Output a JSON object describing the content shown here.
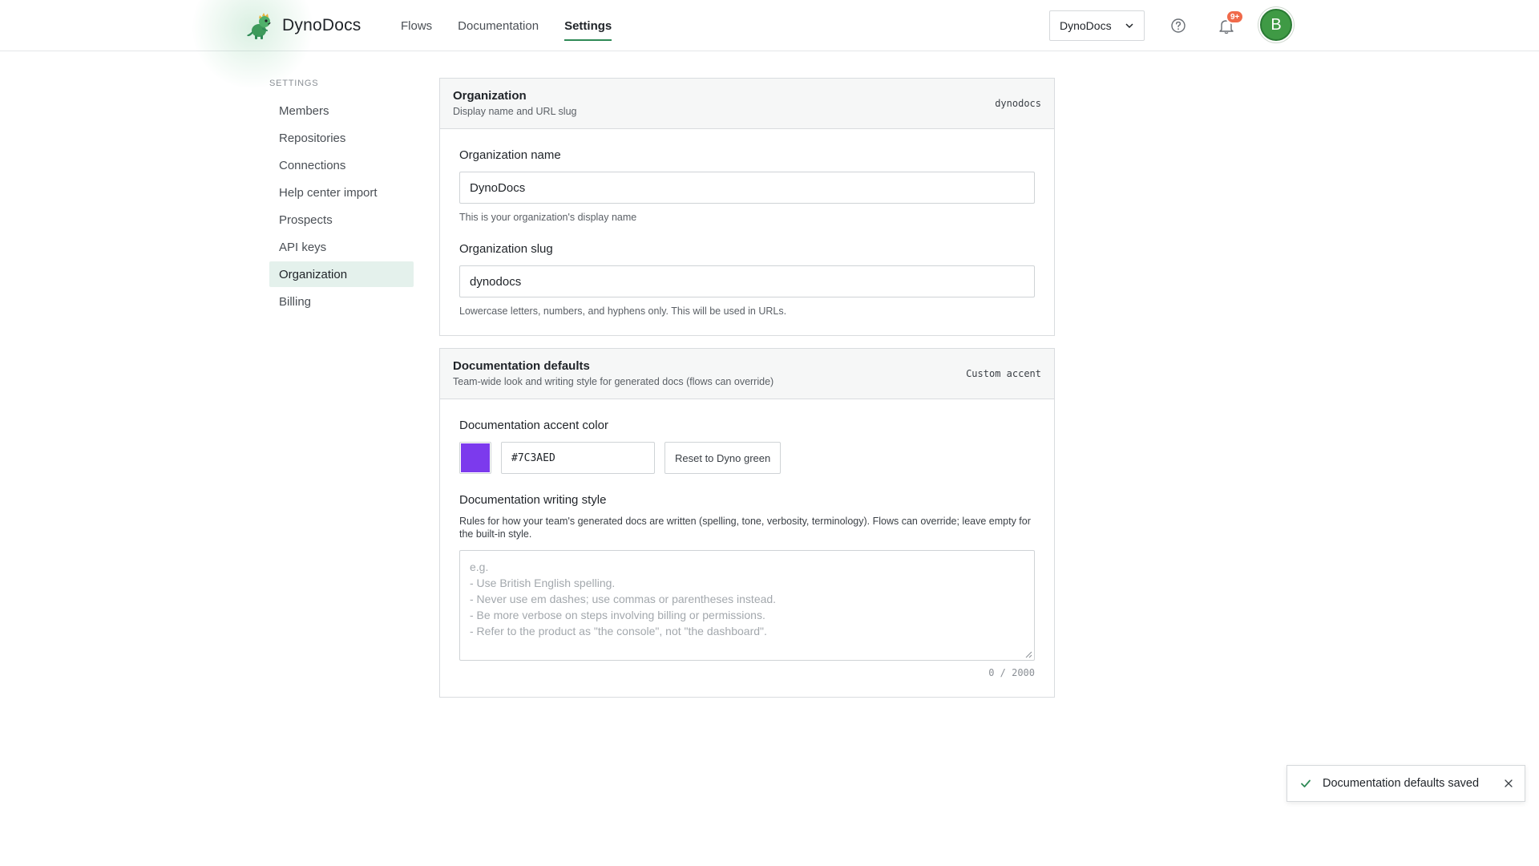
{
  "brand": {
    "name": "DynoDocs",
    "logo_icon": "dino-logo-icon"
  },
  "nav": {
    "items": [
      {
        "label": "Flows",
        "active": false
      },
      {
        "label": "Documentation",
        "active": false
      },
      {
        "label": "Settings",
        "active": true
      }
    ]
  },
  "header": {
    "org_select": "DynoDocs",
    "notification_badge": "9+",
    "avatar_initial": "B"
  },
  "sidebar": {
    "heading": "SETTINGS",
    "items": [
      {
        "label": "Members",
        "active": false
      },
      {
        "label": "Repositories",
        "active": false
      },
      {
        "label": "Connections",
        "active": false
      },
      {
        "label": "Help center import",
        "active": false
      },
      {
        "label": "Prospects",
        "active": false
      },
      {
        "label": "API keys",
        "active": false
      },
      {
        "label": "Organization",
        "active": true
      },
      {
        "label": "Billing",
        "active": false
      }
    ]
  },
  "organization_card": {
    "title": "Organization",
    "subtitle": "Display name and URL slug",
    "meta": "dynodocs",
    "name_label": "Organization name",
    "name_value": "DynoDocs",
    "name_hint": "This is your organization's display name",
    "slug_label": "Organization slug",
    "slug_value": "dynodocs",
    "slug_hint": "Lowercase letters, numbers, and hyphens only. This will be used in URLs."
  },
  "defaults_card": {
    "title": "Documentation defaults",
    "subtitle": "Team-wide look and writing style for generated docs (flows can override)",
    "meta": "Custom accent",
    "accent_label": "Documentation accent color",
    "accent_value": "#7C3AED",
    "accent_color": "#7c3aed",
    "reset_label": "Reset to Dyno green",
    "style_label": "Documentation writing style",
    "style_desc": "Rules for how your team's generated docs are written (spelling, tone, verbosity, terminology). Flows can override; leave empty for the built-in style.",
    "style_placeholder": [
      "e.g.",
      "- Use British English spelling.",
      "- Never use em dashes; use commas or parentheses instead.",
      "- Be more verbose on steps involving billing or permissions.",
      "- Refer to the product as \"the console\", not \"the dashboard\"."
    ],
    "counter": "0 / 2000"
  },
  "toast": {
    "message": "Documentation defaults saved"
  },
  "colors": {
    "brand_green": "#2f8a56",
    "accent": "#7c3aed",
    "badge": "#f06a4a",
    "avatar": "#3f9a45",
    "active_bg": "#e4f1ec"
  }
}
